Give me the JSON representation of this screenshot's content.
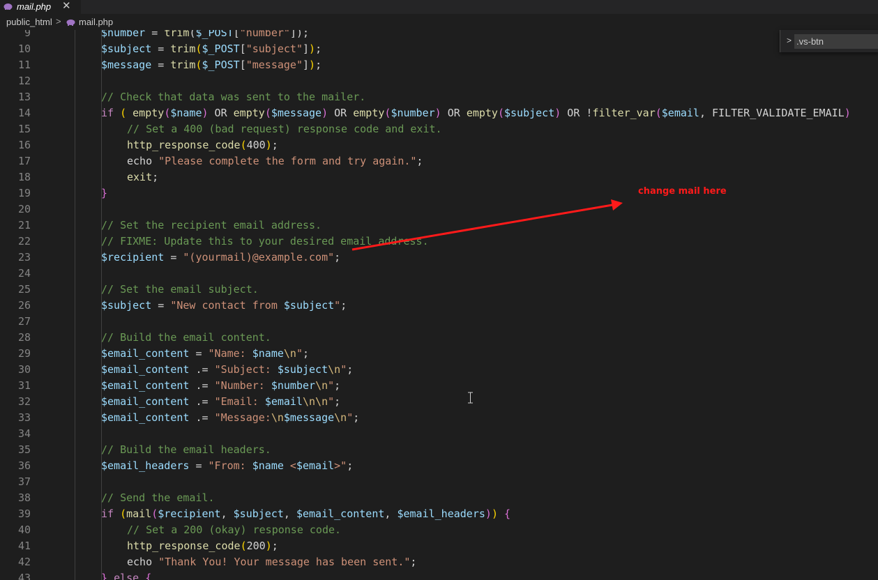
{
  "tab": {
    "label": "mail.php",
    "close": "✕",
    "icon": "php-elephant-icon"
  },
  "breadcrumb": {
    "folder": "public_html",
    "separator": ">",
    "file": "mail.php"
  },
  "find_widget": {
    "value": ".vs-btn",
    "toggle": ">"
  },
  "annotation": {
    "text": "change mail here",
    "color": "#ff1a1a"
  },
  "colors": {
    "keyword": "#c586c0",
    "variable": "#9cdcfe",
    "function": "#dcdcaa",
    "string": "#ce9178",
    "comment": "#6a9955",
    "escape": "#d7ba7d",
    "line_number": "#858585",
    "background": "#1e1e1e"
  },
  "lines": [
    {
      "n": "9",
      "t": [
        [
          "v",
          "$number"
        ],
        [
          "p",
          " = "
        ],
        [
          "f",
          "trim"
        ],
        [
          "p",
          "("
        ],
        [
          "v",
          "$_POST"
        ],
        [
          "p",
          "["
        ],
        [
          "s",
          "\"number\""
        ],
        [
          "p",
          "]);"
        ]
      ]
    },
    {
      "n": "10",
      "t": [
        [
          "v",
          "$subject"
        ],
        [
          "p",
          " = "
        ],
        [
          "f",
          "trim"
        ],
        [
          "b1",
          "("
        ],
        [
          "v",
          "$_POST"
        ],
        [
          "p",
          "["
        ],
        [
          "s",
          "\"subject\""
        ],
        [
          "p",
          "]"
        ],
        [
          "b1",
          ")"
        ],
        [
          "p",
          ";"
        ]
      ]
    },
    {
      "n": "11",
      "t": [
        [
          "v",
          "$message"
        ],
        [
          "p",
          " = "
        ],
        [
          "f",
          "trim"
        ],
        [
          "b1",
          "("
        ],
        [
          "v",
          "$_POST"
        ],
        [
          "p",
          "["
        ],
        [
          "s",
          "\"message\""
        ],
        [
          "p",
          "]"
        ],
        [
          "b1",
          ")"
        ],
        [
          "p",
          ";"
        ]
      ]
    },
    {
      "n": "12",
      "t": []
    },
    {
      "n": "13",
      "t": [
        [
          "c",
          "// Check that data was sent to the mailer."
        ]
      ]
    },
    {
      "n": "14",
      "t": [
        [
          "k",
          "if"
        ],
        [
          "p",
          " "
        ],
        [
          "b1",
          "("
        ],
        [
          "p",
          " "
        ],
        [
          "f",
          "empty"
        ],
        [
          "b2",
          "("
        ],
        [
          "v",
          "$name"
        ],
        [
          "b2",
          ")"
        ],
        [
          "p",
          " OR "
        ],
        [
          "f",
          "empty"
        ],
        [
          "b2",
          "("
        ],
        [
          "v",
          "$message"
        ],
        [
          "b2",
          ")"
        ],
        [
          "p",
          " OR "
        ],
        [
          "f",
          "empty"
        ],
        [
          "b2",
          "("
        ],
        [
          "v",
          "$number"
        ],
        [
          "b2",
          ")"
        ],
        [
          "p",
          " OR "
        ],
        [
          "f",
          "empty"
        ],
        [
          "b2",
          "("
        ],
        [
          "v",
          "$subject"
        ],
        [
          "b2",
          ")"
        ],
        [
          "p",
          " OR !"
        ],
        [
          "f",
          "filter_var"
        ],
        [
          "b2",
          "("
        ],
        [
          "v",
          "$email"
        ],
        [
          "p",
          ", FILTER_VALIDATE_EMAIL"
        ],
        [
          "b2",
          ")"
        ]
      ]
    },
    {
      "n": "15",
      "i": 2,
      "t": [
        [
          "c",
          "// Set a 400 (bad request) response code and exit."
        ]
      ]
    },
    {
      "n": "16",
      "i": 2,
      "t": [
        [
          "f",
          "http_response_code"
        ],
        [
          "b1",
          "("
        ],
        [
          "p",
          "400"
        ],
        [
          "b1",
          ")"
        ],
        [
          "p",
          ";"
        ]
      ]
    },
    {
      "n": "17",
      "i": 2,
      "t": [
        [
          "p",
          "echo "
        ],
        [
          "s",
          "\"Please complete the form and try again.\""
        ],
        [
          "p",
          ";"
        ]
      ]
    },
    {
      "n": "18",
      "i": 2,
      "t": [
        [
          "f",
          "exit"
        ],
        [
          "p",
          ";"
        ]
      ]
    },
    {
      "n": "19",
      "t": [
        [
          "b2",
          "}"
        ]
      ]
    },
    {
      "n": "20",
      "t": []
    },
    {
      "n": "21",
      "t": [
        [
          "c",
          "// Set the recipient email address."
        ]
      ]
    },
    {
      "n": "22",
      "t": [
        [
          "c",
          "// FIXME: Update this to your desired email address."
        ]
      ]
    },
    {
      "n": "23",
      "t": [
        [
          "v",
          "$recipient"
        ],
        [
          "p",
          " = "
        ],
        [
          "s",
          "\"(yourmail)@example.com\""
        ],
        [
          "p",
          ";"
        ]
      ]
    },
    {
      "n": "24",
      "t": []
    },
    {
      "n": "25",
      "t": [
        [
          "c",
          "// Set the email subject."
        ]
      ]
    },
    {
      "n": "26",
      "t": [
        [
          "v",
          "$subject"
        ],
        [
          "p",
          " = "
        ],
        [
          "s",
          "\"New contact from "
        ],
        [
          "v",
          "$subject"
        ],
        [
          "s",
          "\""
        ],
        [
          "p",
          ";"
        ]
      ]
    },
    {
      "n": "27",
      "t": []
    },
    {
      "n": "28",
      "t": [
        [
          "c",
          "// Build the email content."
        ]
      ]
    },
    {
      "n": "29",
      "t": [
        [
          "v",
          "$email_content"
        ],
        [
          "p",
          " = "
        ],
        [
          "s",
          "\"Name: "
        ],
        [
          "v",
          "$name"
        ],
        [
          "e",
          "\\n"
        ],
        [
          "s",
          "\""
        ],
        [
          "p",
          ";"
        ]
      ]
    },
    {
      "n": "30",
      "t": [
        [
          "v",
          "$email_content"
        ],
        [
          "p",
          " .= "
        ],
        [
          "s",
          "\"Subject: "
        ],
        [
          "v",
          "$subject"
        ],
        [
          "e",
          "\\n"
        ],
        [
          "s",
          "\""
        ],
        [
          "p",
          ";"
        ]
      ]
    },
    {
      "n": "31",
      "t": [
        [
          "v",
          "$email_content"
        ],
        [
          "p",
          " .= "
        ],
        [
          "s",
          "\"Number: "
        ],
        [
          "v",
          "$number"
        ],
        [
          "e",
          "\\n"
        ],
        [
          "s",
          "\""
        ],
        [
          "p",
          ";"
        ]
      ]
    },
    {
      "n": "32",
      "t": [
        [
          "v",
          "$email_content"
        ],
        [
          "p",
          " .= "
        ],
        [
          "s",
          "\"Email: "
        ],
        [
          "v",
          "$email"
        ],
        [
          "e",
          "\\n\\n"
        ],
        [
          "s",
          "\""
        ],
        [
          "p",
          ";"
        ]
      ]
    },
    {
      "n": "33",
      "t": [
        [
          "v",
          "$email_content"
        ],
        [
          "p",
          " .= "
        ],
        [
          "s",
          "\"Message:"
        ],
        [
          "e",
          "\\n"
        ],
        [
          "v",
          "$message"
        ],
        [
          "e",
          "\\n"
        ],
        [
          "s",
          "\""
        ],
        [
          "p",
          ";"
        ]
      ]
    },
    {
      "n": "34",
      "t": []
    },
    {
      "n": "35",
      "t": [
        [
          "c",
          "// Build the email headers."
        ]
      ]
    },
    {
      "n": "36",
      "t": [
        [
          "v",
          "$email_headers"
        ],
        [
          "p",
          " = "
        ],
        [
          "s",
          "\"From: "
        ],
        [
          "v",
          "$name"
        ],
        [
          "s",
          " <"
        ],
        [
          "v",
          "$email"
        ],
        [
          "s",
          ">\""
        ],
        [
          "p",
          ";"
        ]
      ]
    },
    {
      "n": "37",
      "t": []
    },
    {
      "n": "38",
      "t": [
        [
          "c",
          "// Send the email."
        ]
      ]
    },
    {
      "n": "39",
      "t": [
        [
          "k",
          "if"
        ],
        [
          "p",
          " "
        ],
        [
          "b1",
          "("
        ],
        [
          "f",
          "mail"
        ],
        [
          "b2",
          "("
        ],
        [
          "v",
          "$recipient"
        ],
        [
          "p",
          ", "
        ],
        [
          "v",
          "$subject"
        ],
        [
          "p",
          ", "
        ],
        [
          "v",
          "$email_content"
        ],
        [
          "p",
          ", "
        ],
        [
          "v",
          "$email_headers"
        ],
        [
          "b2",
          ")"
        ],
        [
          "b1",
          ")"
        ],
        [
          "p",
          " "
        ],
        [
          "b2",
          "{"
        ]
      ]
    },
    {
      "n": "40",
      "i": 2,
      "t": [
        [
          "c",
          "// Set a 200 (okay) response code."
        ]
      ]
    },
    {
      "n": "41",
      "i": 2,
      "t": [
        [
          "f",
          "http_response_code"
        ],
        [
          "b1",
          "("
        ],
        [
          "p",
          "200"
        ],
        [
          "b1",
          ")"
        ],
        [
          "p",
          ";"
        ]
      ]
    },
    {
      "n": "42",
      "i": 2,
      "t": [
        [
          "p",
          "echo "
        ],
        [
          "s",
          "\"Thank You! Your message has been sent.\""
        ],
        [
          "p",
          ";"
        ]
      ]
    },
    {
      "n": "43",
      "t": [
        [
          "b2",
          "}"
        ],
        [
          "p",
          " "
        ],
        [
          "k",
          "else"
        ],
        [
          "p",
          " "
        ],
        [
          "b2",
          "{"
        ]
      ]
    }
  ]
}
